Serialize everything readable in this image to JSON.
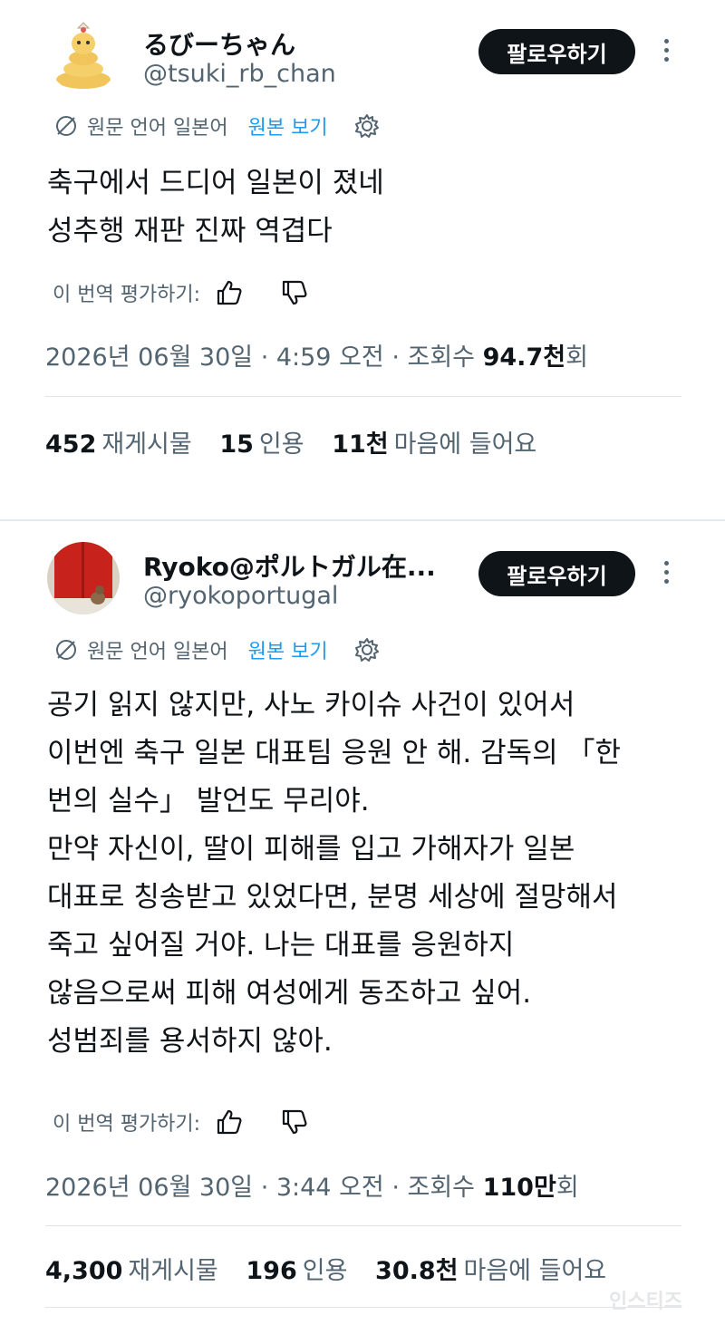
{
  "tweets": [
    {
      "display_name": "るびーちゃん",
      "handle": "@tsuki_rb_chan",
      "follow_label": "팔로우하기",
      "translation_note": "원문 언어 일본어",
      "view_original": "원본 보기",
      "body_lines": [
        "축구에서 드디어 일본이 졌네",
        "성추행 재판 진짜 역겹다"
      ],
      "rate_label": "이 번역 평가하기:",
      "date": "2026년 06월 30일 · 4:59 오전 · 조회수 ",
      "views": "94.7천",
      "views_suffix": "회",
      "reposts_count": "452",
      "reposts_label": "재게시물",
      "quotes_count": "15",
      "quotes_label": "인용",
      "likes_count": "11천",
      "likes_label": "마음에 들어요"
    },
    {
      "display_name": "Ryoko@ポルトガル在...",
      "handle": "@ryokoportugal",
      "follow_label": "팔로우하기",
      "translation_note": "원문 언어 일본어",
      "view_original": "원본 보기",
      "body_lines": [
        "공기 읽지 않지만, 사노 카이슈 사건이 있어서",
        "이번엔 축구 일본 대표팀 응원 안 해. 감독의 「한",
        "번의 실수」 발언도 무리야.",
        "만약 자신이, 딸이 피해를 입고 가해자가 일본",
        "대표로 칭송받고 있었다면, 분명 세상에 절망해서",
        "죽고 싶어질 거야. 나는 대표를 응원하지",
        "않음으로써 피해 여성에게 동조하고 싶어.",
        "성범죄를 용서하지 않아."
      ],
      "rate_label": "이 번역 평가하기:",
      "date": "2026년 06월 30일 · 3:44 오전 · 조회수 ",
      "views": "110만",
      "views_suffix": "회",
      "reposts_count": "4,300",
      "reposts_label": "재게시물",
      "quotes_count": "196",
      "quotes_label": "인용",
      "likes_count": "30.8천",
      "likes_label": "마음에 들어요"
    }
  ],
  "watermark": "인스티즈",
  "colors": {
    "text": "#0f1419",
    "secondary": "#536471",
    "link": "#1d9bf0",
    "button": "#0f1419"
  }
}
